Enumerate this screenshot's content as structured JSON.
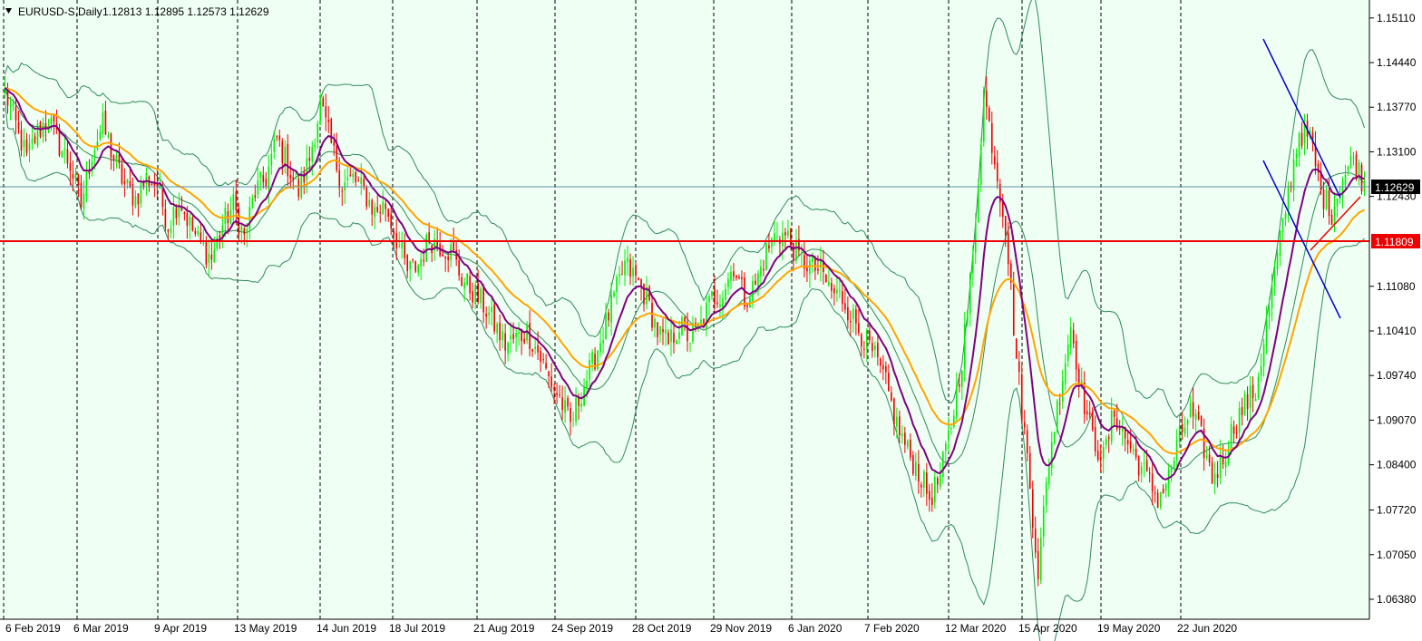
{
  "header": {
    "symbol": "EURUSD-S,Daily",
    "ohlc": "1.12813 1.12895 1.12573 1.12629"
  },
  "colors": {
    "background": "#f0fff4",
    "bull": "#00ee00",
    "bear": "#ee0000",
    "bands": "#2e8b57",
    "ma_fast": "#800080",
    "ma_slow": "#ffa500",
    "support": "#ee0000",
    "trend_down": "#0000cd",
    "trend_up": "#ee0000",
    "price_line": "#5f8fa8"
  },
  "chart_data": {
    "type": "candlestick",
    "y_ticks": [
      "1.15110",
      "1.14440",
      "1.13770",
      "1.13100",
      "1.12430",
      "1.11080",
      "1.10410",
      "1.09740",
      "1.09070",
      "1.08400",
      "1.07720",
      "1.07050",
      "1.06380"
    ],
    "ylim": [
      1.0608,
      1.1538
    ],
    "x_labels": [
      "6 Feb 2019",
      "6 Mar 2019",
      "9 Apr 2019",
      "13 May 2019",
      "14 Jun 2019",
      "18 Jul 2019",
      "21 Aug 2019",
      "24 Sep 2019",
      "28 Oct 2019",
      "29 Nov 2019",
      "6 Jan 2020",
      "7 Feb 2020",
      "12 Mar 2020",
      "15 Apr 2020",
      "19 May 2020",
      "22 Jun 2020"
    ],
    "current_price": "1.12629",
    "support_level": "1.11809",
    "close_anchors": [
      [
        0,
        1.14
      ],
      [
        4,
        1.135
      ],
      [
        8,
        1.13
      ],
      [
        12,
        1.134
      ],
      [
        16,
        1.136
      ],
      [
        20,
        1.132
      ],
      [
        24,
        1.129
      ],
      [
        28,
        1.123
      ],
      [
        32,
        1.131
      ],
      [
        36,
        1.135
      ],
      [
        40,
        1.13
      ],
      [
        44,
        1.126
      ],
      [
        48,
        1.124
      ],
      [
        52,
        1.127
      ],
      [
        56,
        1.126
      ],
      [
        60,
        1.12
      ],
      [
        64,
        1.124
      ],
      [
        68,
        1.12
      ],
      [
        72,
        1.117
      ],
      [
        76,
        1.115
      ],
      [
        80,
        1.12
      ],
      [
        84,
        1.123
      ],
      [
        88,
        1.118
      ],
      [
        92,
        1.125
      ],
      [
        96,
        1.127
      ],
      [
        100,
        1.133
      ],
      [
        104,
        1.129
      ],
      [
        108,
        1.125
      ],
      [
        112,
        1.13
      ],
      [
        116,
        1.138
      ],
      [
        120,
        1.132
      ],
      [
        124,
        1.126
      ],
      [
        128,
        1.127
      ],
      [
        132,
        1.125
      ],
      [
        136,
        1.122
      ],
      [
        140,
        1.123
      ],
      [
        144,
        1.118
      ],
      [
        148,
        1.113
      ],
      [
        152,
        1.114
      ],
      [
        156,
        1.118
      ],
      [
        160,
        1.117
      ],
      [
        164,
        1.116
      ],
      [
        168,
        1.112
      ],
      [
        172,
        1.11
      ],
      [
        176,
        1.108
      ],
      [
        180,
        1.105
      ],
      [
        184,
        1.102
      ],
      [
        188,
        1.103
      ],
      [
        192,
        1.104
      ],
      [
        196,
        1.101
      ],
      [
        200,
        1.097
      ],
      [
        204,
        1.094
      ],
      [
        208,
        1.09
      ],
      [
        212,
        1.095
      ],
      [
        216,
        1.099
      ],
      [
        220,
        1.104
      ],
      [
        224,
        1.109
      ],
      [
        228,
        1.114
      ],
      [
        232,
        1.112
      ],
      [
        236,
        1.109
      ],
      [
        240,
        1.104
      ],
      [
        244,
        1.102
      ],
      [
        248,
        1.105
      ],
      [
        252,
        1.103
      ],
      [
        256,
        1.105
      ],
      [
        260,
        1.109
      ],
      [
        264,
        1.11
      ],
      [
        268,
        1.114
      ],
      [
        272,
        1.109
      ],
      [
        276,
        1.111
      ],
      [
        280,
        1.116
      ],
      [
        284,
        1.119
      ],
      [
        288,
        1.118
      ],
      [
        292,
        1.115
      ],
      [
        296,
        1.114
      ],
      [
        300,
        1.113
      ],
      [
        304,
        1.11
      ],
      [
        308,
        1.109
      ],
      [
        312,
        1.106
      ],
      [
        316,
        1.103
      ],
      [
        320,
        1.1
      ],
      [
        324,
        1.096
      ],
      [
        328,
        1.09
      ],
      [
        332,
        1.086
      ],
      [
        336,
        1.083
      ],
      [
        340,
        1.079
      ],
      [
        344,
        1.082
      ],
      [
        348,
        1.09
      ],
      [
        352,
        1.1
      ],
      [
        356,
        1.115
      ],
      [
        360,
        1.14
      ],
      [
        364,
        1.13
      ],
      [
        368,
        1.12
      ],
      [
        372,
        1.1
      ],
      [
        376,
        1.085
      ],
      [
        380,
        1.068
      ],
      [
        384,
        1.085
      ],
      [
        388,
        1.095
      ],
      [
        392,
        1.105
      ],
      [
        396,
        1.095
      ],
      [
        400,
        1.088
      ],
      [
        404,
        1.085
      ],
      [
        408,
        1.092
      ],
      [
        412,
        1.088
      ],
      [
        416,
        1.085
      ],
      [
        420,
        1.082
      ],
      [
        424,
        1.079
      ],
      [
        428,
        1.082
      ],
      [
        432,
        1.088
      ],
      [
        436,
        1.092
      ],
      [
        440,
        1.088
      ],
      [
        444,
        1.082
      ],
      [
        448,
        1.085
      ],
      [
        452,
        1.09
      ],
      [
        456,
        1.093
      ],
      [
        460,
        1.095
      ],
      [
        464,
        1.105
      ],
      [
        468,
        1.115
      ],
      [
        472,
        1.125
      ],
      [
        476,
        1.134
      ],
      [
        480,
        1.133
      ],
      [
        484,
        1.125
      ],
      [
        488,
        1.122
      ],
      [
        492,
        1.127
      ],
      [
        496,
        1.13
      ],
      [
        500,
        1.126
      ]
    ]
  }
}
